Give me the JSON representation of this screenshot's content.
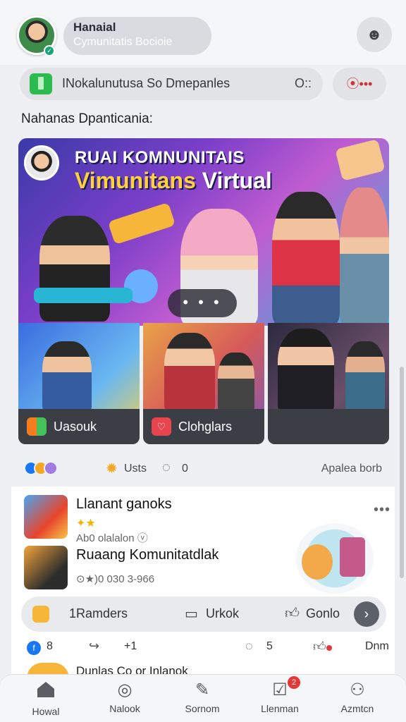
{
  "header": {
    "name": "Hanaial",
    "subtitle": "Cymunitatis Bocioie",
    "online_icon": "check-icon",
    "profile_icon": "face-icon"
  },
  "search": {
    "text": "INokalunutusa So  Dmepanles",
    "extra": "O:: ",
    "icon": "green-app-icon",
    "more_icon": "record-more-icon",
    "more_label": "⦿•••"
  },
  "section_title": "Nahanas Dpanticania:",
  "hero": {
    "title_line1": "RUAI KOMNUNITAIS",
    "title_line2_a": "Vimunitans ",
    "title_line2_b": "Virtual",
    "dots": "• • •"
  },
  "thumbnails": [
    {
      "label": "Uasouk"
    },
    {
      "label": "Clohglars"
    },
    {
      "label": ""
    }
  ],
  "reactions": {
    "count_label": "Usts",
    "comments": "0",
    "right_link": "Apalea borb"
  },
  "posts": [
    {
      "title": "Llanant ganoks",
      "sub": "✦★",
      "meta": "Ab0 olalalon ⓥ",
      "menu": "•••"
    },
    {
      "title": "Ruaang Komunitatdlak",
      "meta": "⊙★)0 030 3-966"
    }
  ],
  "actions": {
    "a1": "1Ramders",
    "a2": "Urkok",
    "a3": "Gonlo",
    "next": "›"
  },
  "stats": {
    "likes": "8",
    "shares": "+1",
    "comments": "5",
    "right": "Dnm"
  },
  "peek_text": "Dunlas Co or Inlanok",
  "nav": [
    {
      "label": "Howal",
      "icon": "home-icon"
    },
    {
      "label": "Nalook",
      "icon": "compass-icon"
    },
    {
      "label": "Sornom",
      "icon": "edit-icon"
    },
    {
      "label": "Llenman",
      "icon": "checklist-icon",
      "badge": "2"
    },
    {
      "label": "Azmtcn",
      "icon": "person-icon"
    }
  ]
}
